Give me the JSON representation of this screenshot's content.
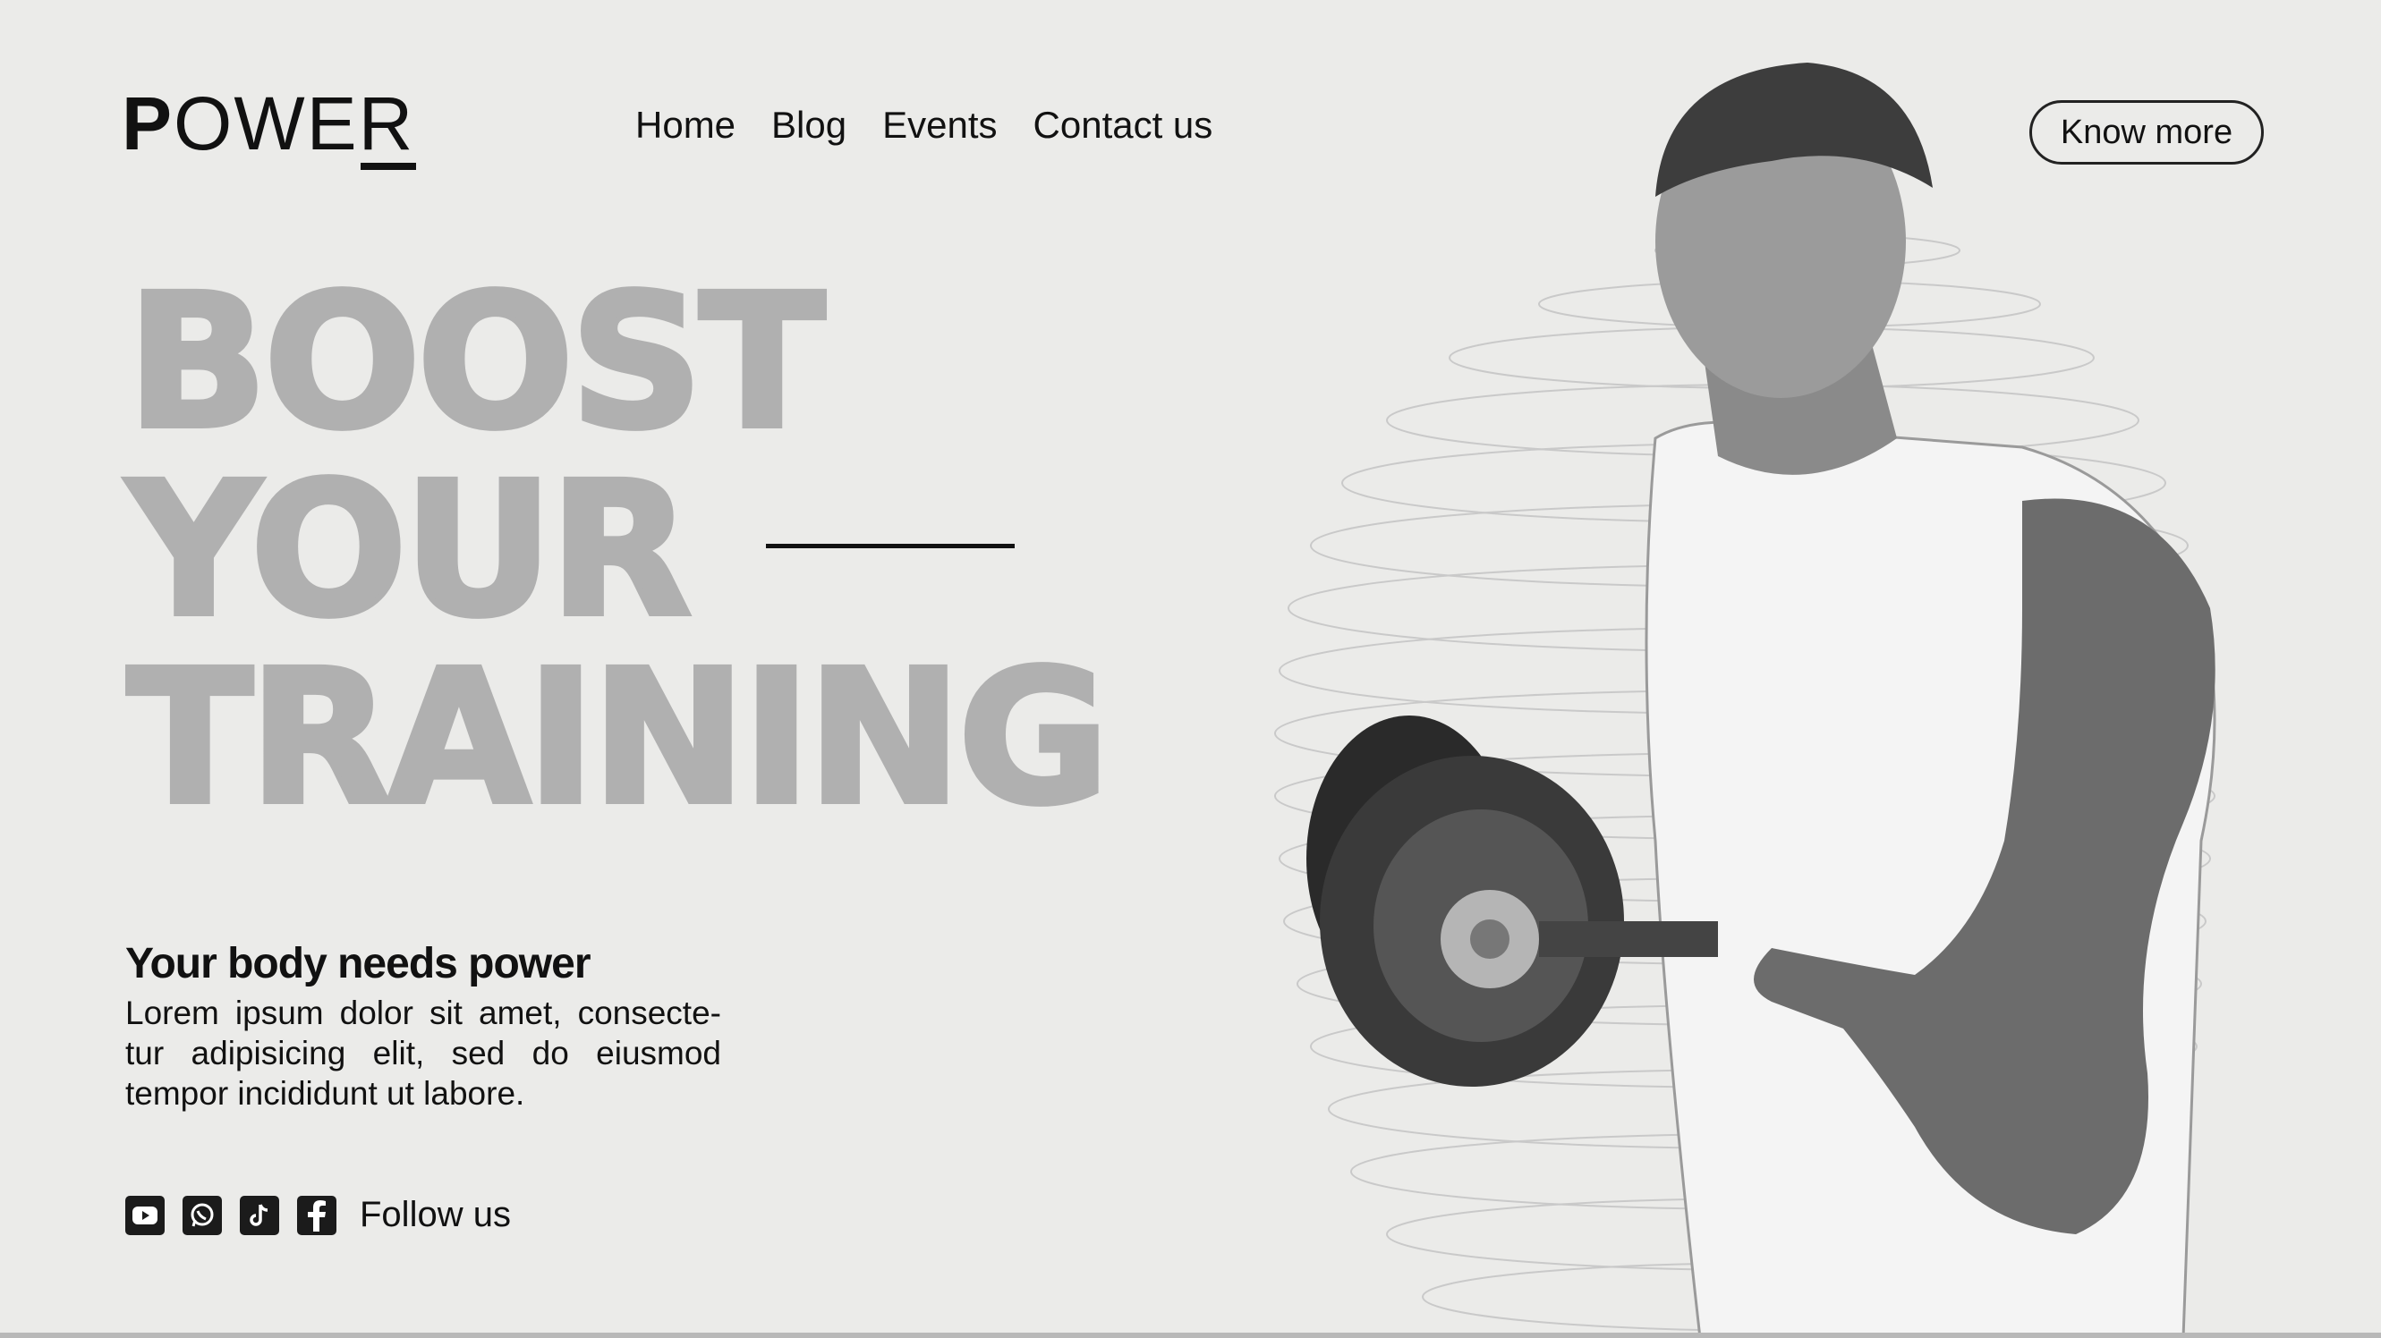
{
  "header": {
    "logo_first": "P",
    "logo_rest": "OWER",
    "nav": [
      "Home",
      "Blog",
      "Events",
      "Contact us"
    ],
    "cta_label": "Know more"
  },
  "hero": {
    "lines": [
      "BOOST",
      "YOUR",
      "TRAINING"
    ]
  },
  "intro": {
    "subtitle": "Your body needs power",
    "body": "Lorem ipsum dolor sit amet, consecte-tur adipisicing elit, sed do eiusmod tempor incididunt ut labore."
  },
  "social": {
    "icons": [
      "youtube-icon",
      "whatsapp-icon",
      "tiktok-icon",
      "facebook-icon"
    ],
    "follow_label": "Follow us"
  },
  "colors": {
    "background": "#ebebe9",
    "hero_text": "#b0b0b0",
    "text": "#111111"
  }
}
